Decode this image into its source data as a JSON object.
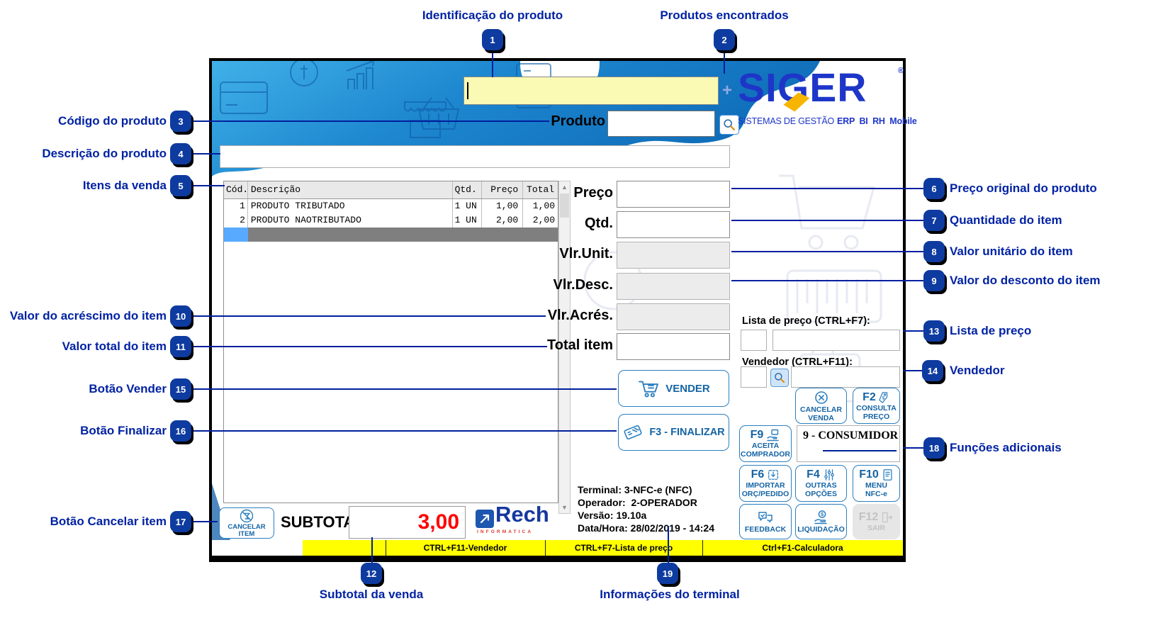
{
  "colors": {
    "accent_blue": "#2b7fc0",
    "button_text_blue": "#1464a5",
    "callout_blue": "#0022a3",
    "badge_fill": "#0e3ba0",
    "search_yellow": "#fafab4",
    "statusbar_yellow": "#ffff00",
    "subtotal_red": "#ff0000",
    "logo_blue": "#1e36c8",
    "selected_row_gray": "#7f7f7f",
    "selected_row_blue": "#57aaff"
  },
  "callouts": [
    {
      "num": "1",
      "label": "Identificação do produto"
    },
    {
      "num": "2",
      "label": "Produtos encontrados"
    },
    {
      "num": "3",
      "label": "Código do produto"
    },
    {
      "num": "4",
      "label": "Descrição do produto"
    },
    {
      "num": "5",
      "label": "Itens da venda"
    },
    {
      "num": "6",
      "label": "Preço original do produto"
    },
    {
      "num": "7",
      "label": "Quantidade do item"
    },
    {
      "num": "8",
      "label": "Valor unitário do item"
    },
    {
      "num": "9",
      "label": "Valor do desconto do item"
    },
    {
      "num": "10",
      "label": "Valor do acréscimo do item"
    },
    {
      "num": "11",
      "label": "Valor total do item"
    },
    {
      "num": "12",
      "label": "Subtotal da venda"
    },
    {
      "num": "13",
      "label": "Lista de preço"
    },
    {
      "num": "14",
      "label": "Vendedor"
    },
    {
      "num": "15",
      "label": "Botão Vender"
    },
    {
      "num": "16",
      "label": "Botão Finalizar"
    },
    {
      "num": "17",
      "label": "Botão Cancelar item"
    },
    {
      "num": "18",
      "label": "Funções adicionais"
    },
    {
      "num": "19",
      "label": "Informações do terminal"
    }
  ],
  "header": {
    "search_value": "",
    "plus_icon": "+",
    "produto_label": "Produto",
    "produto_value": "",
    "logo": {
      "brand": "SIGER",
      "reg": "®",
      "subtitle": "SISTEMAS DE GESTÃO",
      "subtitle_bold": "ERP  BI  RH  Mobile"
    }
  },
  "description_value": "",
  "table": {
    "headers": {
      "cod": "Cód.",
      "desc": "Descrição",
      "qtd": "Qtd.",
      "preco": "Preço",
      "total": "Total"
    },
    "rows": [
      {
        "cod": "1",
        "desc": "PRODUTO TRIBUTADO",
        "qtd": "1 UN",
        "preco": "1,00",
        "total": "1,00"
      },
      {
        "cod": "2",
        "desc": "PRODUTO NAOTRIBUTADO",
        "qtd": "1 UN",
        "preco": "2,00",
        "total": "2,00"
      }
    ]
  },
  "form": {
    "preco": {
      "label": "Preço",
      "value": ""
    },
    "qtd": {
      "label": "Qtd.",
      "value": ""
    },
    "vlrunit": {
      "label": "Vlr.Unit.",
      "value": ""
    },
    "vlrdesc": {
      "label": "Vlr.Desc.",
      "value": ""
    },
    "vlracres": {
      "label": "Vlr.Acrés.",
      "value": ""
    },
    "totalitem": {
      "label": "Total item",
      "value": ""
    }
  },
  "lista_preco": {
    "label": "Lista de preço (CTRL+F7):",
    "code_value": "",
    "name_value": ""
  },
  "vendedor": {
    "label": "Vendedor (CTRL+F11):",
    "code_value": "",
    "name_value": ""
  },
  "consumidor": "9 - CONSUMIDOR",
  "buttons": {
    "vender": {
      "label": "VENDER"
    },
    "finalizar": {
      "label": "F3 - FINALIZAR"
    },
    "cancelar_venda": {
      "line1": "CANCELAR",
      "line2": "VENDA"
    },
    "f2": {
      "key": "F2",
      "line1": "CONSULTA",
      "line2": "PREÇO"
    },
    "f9": {
      "key": "F9",
      "line1": "ACEITA",
      "line2": "COMPRADOR"
    },
    "f6": {
      "key": "F6",
      "line1": "IMPORTAR",
      "line2": "ORÇ/PEDIDO"
    },
    "f4": {
      "key": "F4",
      "line1": "OUTRAS",
      "line2": "OPÇÕES"
    },
    "f10": {
      "key": "F10",
      "line1": "MENU",
      "line2": "NFC-e"
    },
    "feedback": {
      "line1": "FEEDBACK"
    },
    "liquidacao": {
      "line1": "LIQUIDAÇÃO"
    },
    "f12": {
      "key": "F12",
      "line1": "SAIR"
    },
    "cancelar_item": {
      "label": "CANCELAR ITEM"
    }
  },
  "terminal": {
    "line1": "Terminal: 3-NFC-e (NFC)",
    "line2": "Operador:  2-OPERADOR",
    "line3": "Versão: 19.10a",
    "line4": "Data/Hora: 28/02/2019 - 14:24"
  },
  "subtotal": {
    "label": "SUBTOTAL",
    "value": "3,00"
  },
  "rech": {
    "brand": "Rech",
    "sub": "INFORMATICA"
  },
  "statusbar": {
    "item1": "CTRL+F11-Vendedor",
    "item2": "CTRL+F7-Lista de preço",
    "item3": "Ctrl+F1-Calculadora"
  }
}
